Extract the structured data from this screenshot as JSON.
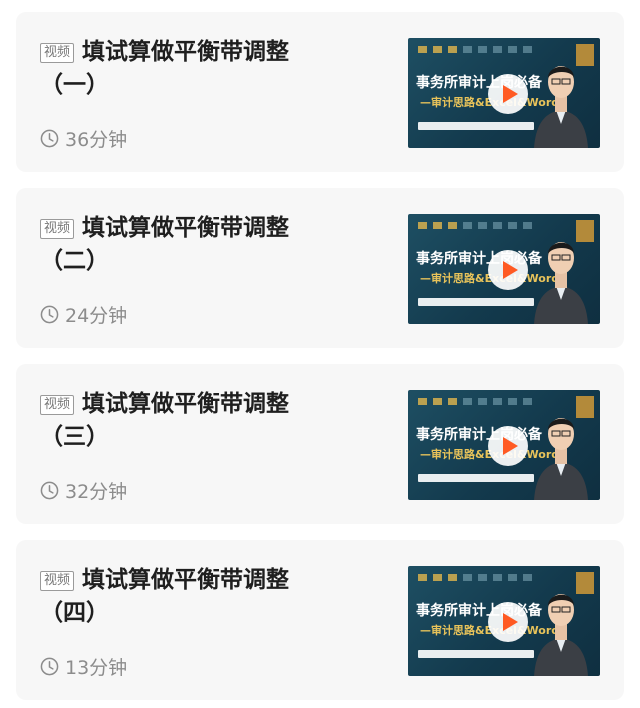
{
  "items": [
    {
      "tag": "视频",
      "title_line1": "填试算做平衡带调整",
      "title_line2": "（一）",
      "duration": "36分钟",
      "thumb_headline": "事务所审计上岗必备",
      "thumb_sub": "—审计思路&Excel&Word"
    },
    {
      "tag": "视频",
      "title_line1": "填试算做平衡带调整",
      "title_line2": "（二）",
      "duration": "24分钟",
      "thumb_headline": "事务所审计上岗必备",
      "thumb_sub": "—审计思路&Excel&Word"
    },
    {
      "tag": "视频",
      "title_line1": "填试算做平衡带调整",
      "title_line2": "（三）",
      "duration": "32分钟",
      "thumb_headline": "事务所审计上岗必备",
      "thumb_sub": "—审计思路&Excel&Word"
    },
    {
      "tag": "视频",
      "title_line1": "填试算做平衡带调整",
      "title_line2": "（四）",
      "duration": "13分钟",
      "thumb_headline": "事务所审计上岗必备",
      "thumb_sub": "—审计思路&Excel&Word"
    }
  ],
  "icons": {
    "duration": "clock-icon",
    "play": "play-icon"
  },
  "colors": {
    "play_accent": "#ff5a23",
    "card_bg": "#f7f7f7",
    "thumb_bg": "#1a465a"
  }
}
